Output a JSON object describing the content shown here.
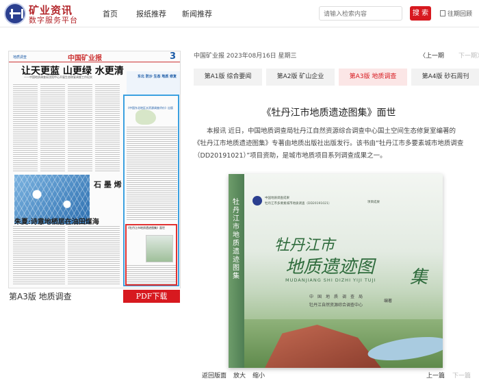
{
  "header": {
    "brand_line1": "矿业资讯",
    "brand_line2": "数字服务平台",
    "nav": [
      "首页",
      "报纸推荐",
      "新闻推荐"
    ],
    "search_placeholder": "请输入检索内容",
    "search_button": "搜 索",
    "past_issues": "往期回顾"
  },
  "paper_preview": {
    "section_tag": "地质调查",
    "masthead": "中国矿业报",
    "page_number": "3",
    "headline": "让天更蓝 山更绿 水更清",
    "subline": "——中国地质调查局沈阳中心开展生态修复调查工作纪实",
    "right_box": "东北 防沙 生态 地质 修复",
    "blue_article_title": "《中国东北地区水资源调查评价》出版",
    "red_article_title": "《牡丹江市地质遗迹图集》面世",
    "graphene_label": "石 墨 烯",
    "headline2": "朱夏:诗意地栖居在油田煤海",
    "caption": "第A3版 地质调查",
    "pdf_button": "PDF下载"
  },
  "article": {
    "date_line": "中国矿业报 2023年08月16日 星期三",
    "prev": "〈上一期",
    "next": "下一期〉",
    "tabs": [
      {
        "label": "第A1版 综合要闻",
        "active": false
      },
      {
        "label": "第A2版 矿山企业",
        "active": false
      },
      {
        "label": "第A3版 地质调查",
        "active": true
      },
      {
        "label": "第A4版 砂石周刊",
        "active": false
      }
    ],
    "title": "《牡丹江市地质遗迹图集》面世",
    "body": "本报讯 近日，中国地质调查局牡丹江自然资源综合调查中心国土空间生态修复室编著的《牡丹江市地质遗迹图集》专著由地质出版社出版发行。该书由“牡丹江市多要素城市地质调查（DD20191021）”项目资助，是城市地质项目系列调查成果之一。"
  },
  "book_cover": {
    "spine_title": "牡丹江市地质遗迹图集",
    "series_line1": "中国地质调查成果",
    "series_line2": "牡丹江市多要素城市地质调查（DD20191021）",
    "series_tag": "项目成果",
    "title_line1": "牡丹江市",
    "title_line2": "地质遗迹图",
    "title_line3": "集",
    "pinyin": "MUDANJIANG SHI DIZHI YIJI TUJI",
    "org1": "中国地质调查局",
    "org2": "牡丹江自然资源综合调查中心",
    "editor": "编著"
  },
  "bottom_bar": {
    "back": "返回版面",
    "zoom_in": "放大",
    "zoom_out": "缩小",
    "prev_article": "上一篇",
    "next_article": "下一篇"
  },
  "colors": {
    "accent_red": "#d7191f",
    "brand_red": "#b3262b",
    "highlight_blue": "#3aa0e0"
  }
}
